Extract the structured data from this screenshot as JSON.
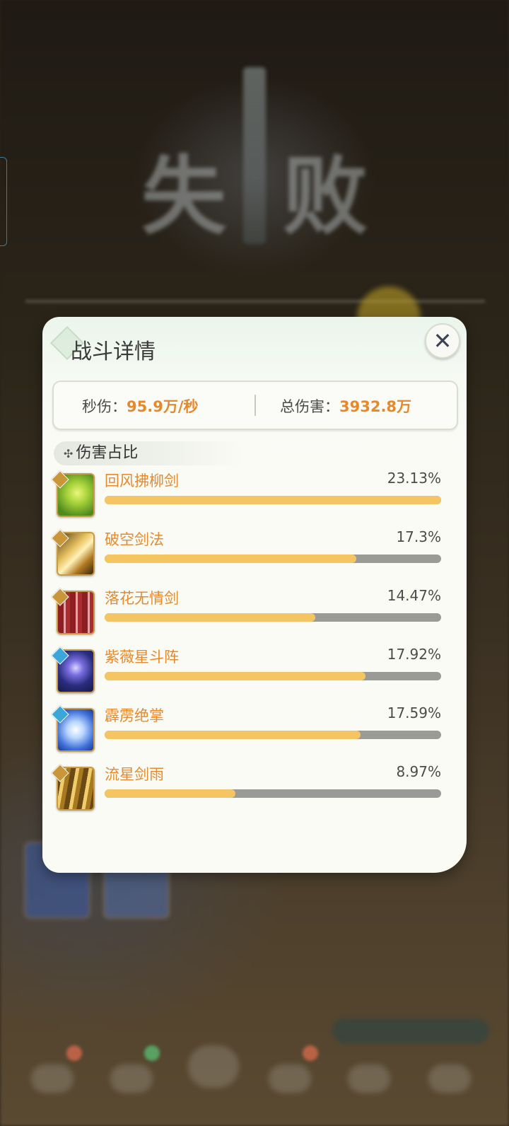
{
  "background": {
    "title": "失败"
  },
  "dialog": {
    "title": "战斗详情",
    "close_icon": "close-icon",
    "stats": {
      "dps_label": "秒伤：",
      "dps_value": "95.9万/秒",
      "total_label": "总伤害：",
      "total_value": "3932.8万"
    },
    "section": {
      "marker": "✣",
      "title": "伤害占比"
    },
    "skills": [
      {
        "name": "回风拂柳剑",
        "percent": "23.13%",
        "ratio": 1.0,
        "icon": "green-wind-sword-icon",
        "badge": "gold"
      },
      {
        "name": "破空剑法",
        "percent": "17.3%",
        "ratio": 0.748,
        "icon": "golden-sword-strike-icon",
        "badge": "gold"
      },
      {
        "name": "落花无情剑",
        "percent": "14.47%",
        "ratio": 0.626,
        "icon": "red-swords-icon",
        "badge": "gold"
      },
      {
        "name": "紫薇星斗阵",
        "percent": "17.92%",
        "ratio": 0.775,
        "icon": "star-array-icon",
        "badge": "blue"
      },
      {
        "name": "霹雳绝掌",
        "percent": "17.59%",
        "ratio": 0.76,
        "icon": "thunder-palm-icon",
        "badge": "blue"
      },
      {
        "name": "流星剑雨",
        "percent": "8.97%",
        "ratio": 0.388,
        "icon": "sword-rain-icon",
        "badge": "gold"
      }
    ]
  },
  "colors": {
    "accent": "#e7892a",
    "bar_fill": "#f5c563",
    "bar_track": "#9a9a97"
  }
}
